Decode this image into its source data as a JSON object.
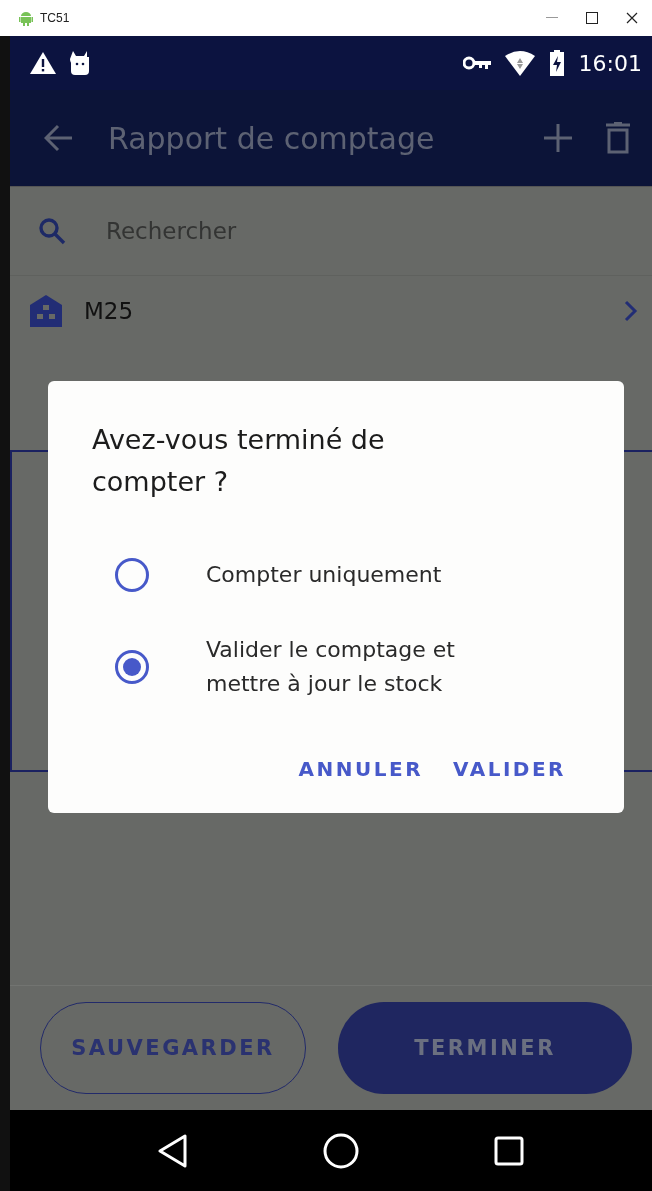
{
  "window": {
    "title": "TC51"
  },
  "status_bar": {
    "time": "16:01"
  },
  "app_bar": {
    "title": "Rapport de comptage"
  },
  "search": {
    "placeholder": "Rechercher"
  },
  "location": {
    "label": "M25"
  },
  "dialog": {
    "title": "Avez-vous terminé de compter ?",
    "options": [
      {
        "label": "Compter uniquement",
        "selected": false
      },
      {
        "label": "Valider le comptage et mettre à jour le stock",
        "selected": true
      }
    ],
    "buttons": [
      "ANNULER",
      "VALIDER"
    ]
  },
  "footer": {
    "buttons": [
      {
        "label": "SAUVEGARDER",
        "kind": "outlined"
      },
      {
        "label": "TERMINER",
        "kind": "filled"
      }
    ]
  }
}
